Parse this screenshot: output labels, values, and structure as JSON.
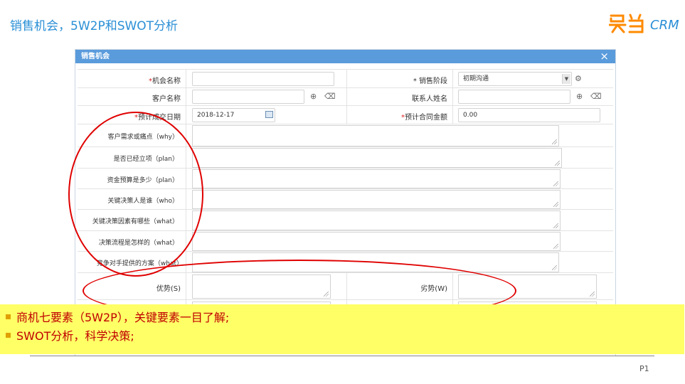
{
  "slide": {
    "title": "销售机会，5W2P和SWOT分析",
    "page": "P1"
  },
  "logo": {
    "text": "CRM",
    "mark": "灵当",
    "brand_color": "#ff8a00"
  },
  "dialog": {
    "title": "销售机会",
    "close_icon": "×",
    "fields": {
      "opportunity_name": {
        "label": "*机会名称",
        "value": ""
      },
      "sales_stage": {
        "label": "* 销售阶段",
        "value": "初期沟通"
      },
      "customer_name": {
        "label": "客户名称",
        "value": ""
      },
      "contact_name": {
        "label": "联系人姓名",
        "value": ""
      },
      "expected_close_date": {
        "label": "*预计成交日期",
        "value": "2018-12-17"
      },
      "expected_amount": {
        "label": "*预计合同金额",
        "value": "0.00"
      },
      "need_why": {
        "label": "客户需求或痛点（why）"
      },
      "project_plan": {
        "label": "是否已经立项（plan）"
      },
      "budget_plan": {
        "label": "资金预算是多少（plan）"
      },
      "decision_who": {
        "label": "关键决策人是谁（who）"
      },
      "factors_what": {
        "label": "关键决策因素有哪些（what）"
      },
      "process_what": {
        "label": "决策流程是怎样的（what）"
      },
      "competitor_what": {
        "label": "竞争对手提供的方案（what）"
      },
      "strengths": {
        "label": "优势(S)"
      },
      "weaknesses": {
        "label": "劣势(W)"
      }
    }
  },
  "notes": [
    "商机七要素（5W2P），关键要素一目了解;",
    "SWOT分析，科学决策;"
  ],
  "colors": {
    "title_blue": "#2a8fd6",
    "header_blue": "#5a9bdc",
    "highlight": "#ffff66",
    "annotation_red": "#e00000",
    "note_text": "#c00000"
  }
}
